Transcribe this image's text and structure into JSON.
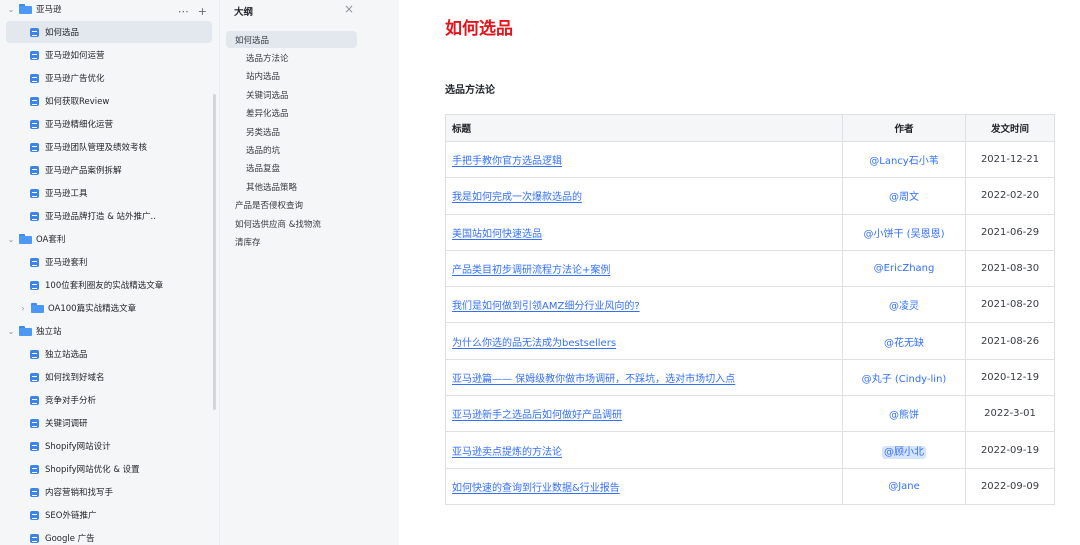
{
  "tree": {
    "rows": [
      {
        "label": "亚马逊",
        "type": "folder",
        "level": 0,
        "caret": "⌄"
      },
      {
        "label": "如何选品",
        "type": "doc",
        "level": 1,
        "active": true
      },
      {
        "label": "亚马逊如何运营",
        "type": "doc",
        "level": 1
      },
      {
        "label": "亚马逊广告优化",
        "type": "doc",
        "level": 1
      },
      {
        "label": "如何获取Review",
        "type": "doc",
        "level": 1
      },
      {
        "label": "亚马逊精细化运营",
        "type": "doc",
        "level": 1
      },
      {
        "label": "亚马逊团队管理及绩效考核",
        "type": "doc",
        "level": 1
      },
      {
        "label": "亚马逊产品案例拆解",
        "type": "doc",
        "level": 1
      },
      {
        "label": "亚马逊工具",
        "type": "doc",
        "level": 1
      },
      {
        "label": "亚马逊品牌打造 & 站外推广..",
        "type": "doc",
        "level": 1
      },
      {
        "label": "OA套利",
        "type": "folder",
        "level": 0,
        "caret": "⌄"
      },
      {
        "label": "亚马逊套利",
        "type": "doc",
        "level": 1
      },
      {
        "label": "100位套利圈友的实战精选文章",
        "type": "doc",
        "level": 1
      },
      {
        "label": "OA100篇实战精选文章",
        "type": "folder",
        "level": 1,
        "caret": "›"
      },
      {
        "label": "独立站",
        "type": "folder",
        "level": 0,
        "caret": "⌄"
      },
      {
        "label": "独立站选品",
        "type": "doc",
        "level": 1
      },
      {
        "label": "如何找到好域名",
        "type": "doc",
        "level": 1
      },
      {
        "label": "竞争对手分析",
        "type": "doc",
        "level": 1
      },
      {
        "label": "关键词调研",
        "type": "doc",
        "level": 1
      },
      {
        "label": "Shopify网站设计",
        "type": "doc",
        "level": 1
      },
      {
        "label": "Shopify网站优化 & 设置",
        "type": "doc",
        "level": 1
      },
      {
        "label": "内容营销和找写手",
        "type": "doc",
        "level": 1
      },
      {
        "label": "SEO外链推广",
        "type": "doc",
        "level": 1
      },
      {
        "label": "Google 广告",
        "type": "doc",
        "level": 1
      }
    ],
    "more_icon": "⋯",
    "add_icon": "+"
  },
  "outline": {
    "title": "大纲",
    "close_icon": "×",
    "items": [
      {
        "label": "如何选品",
        "level": 1,
        "active": true
      },
      {
        "label": "选品方法论",
        "level": 2
      },
      {
        "label": "站内选品",
        "level": 2
      },
      {
        "label": "关键词选品",
        "level": 2
      },
      {
        "label": "差异化选品",
        "level": 2
      },
      {
        "label": "另类选品",
        "level": 2
      },
      {
        "label": "选品的坑",
        "level": 2
      },
      {
        "label": "选品复盘",
        "level": 2
      },
      {
        "label": "其他选品策略",
        "level": 2
      },
      {
        "label": "产品是否侵权查询",
        "level": 1
      },
      {
        "label": "如何选供应商 &找物流",
        "level": 1
      },
      {
        "label": "清库存",
        "level": 1
      }
    ]
  },
  "document": {
    "title": "如何选品",
    "section": "选品方法论",
    "table": {
      "headers": [
        "标题",
        "作者",
        "发文时间"
      ],
      "rows": [
        {
          "title": "手把手教你官方选品逻辑",
          "author": "@Lancy石小苇",
          "date": "2021-12-21"
        },
        {
          "title": "我是如何完成一次爆款选品的",
          "author": "@周文",
          "date": "2022-02-20"
        },
        {
          "title": "美国站如何快速选品",
          "author": "@小饼干 (吴恩恩)",
          "date": "2021-06-29"
        },
        {
          "title": "产品类目初步调研流程方法论+案例",
          "author": "@EricZhang",
          "date": "2021-08-30"
        },
        {
          "title": "我们是如何做到引领AMZ细分行业风向的?",
          "author": "@凌灵",
          "date": "2021-08-20"
        },
        {
          "title": "为什么你选的品无法成为bestsellers",
          "author": "@花无缺",
          "date": "2021-08-26"
        },
        {
          "title": "亚马逊篇—— 保姆级教你做市场调研，不踩坑，选对市场切入点",
          "author": "@丸子 (Cindy-lin)",
          "date": "2020-12-19"
        },
        {
          "title": "亚马逊新手之选品后如何做好产品调研",
          "author": "@熊饼",
          "date": "2022-3-01"
        },
        {
          "title": "亚马逊卖点提炼的方法论",
          "author": "@顾小北",
          "date": "2022-09-19",
          "highlight": true
        },
        {
          "title": "如何快速的查询到行业数据&行业报告",
          "author": "@Jane",
          "date": "2022-09-09"
        }
      ]
    }
  }
}
